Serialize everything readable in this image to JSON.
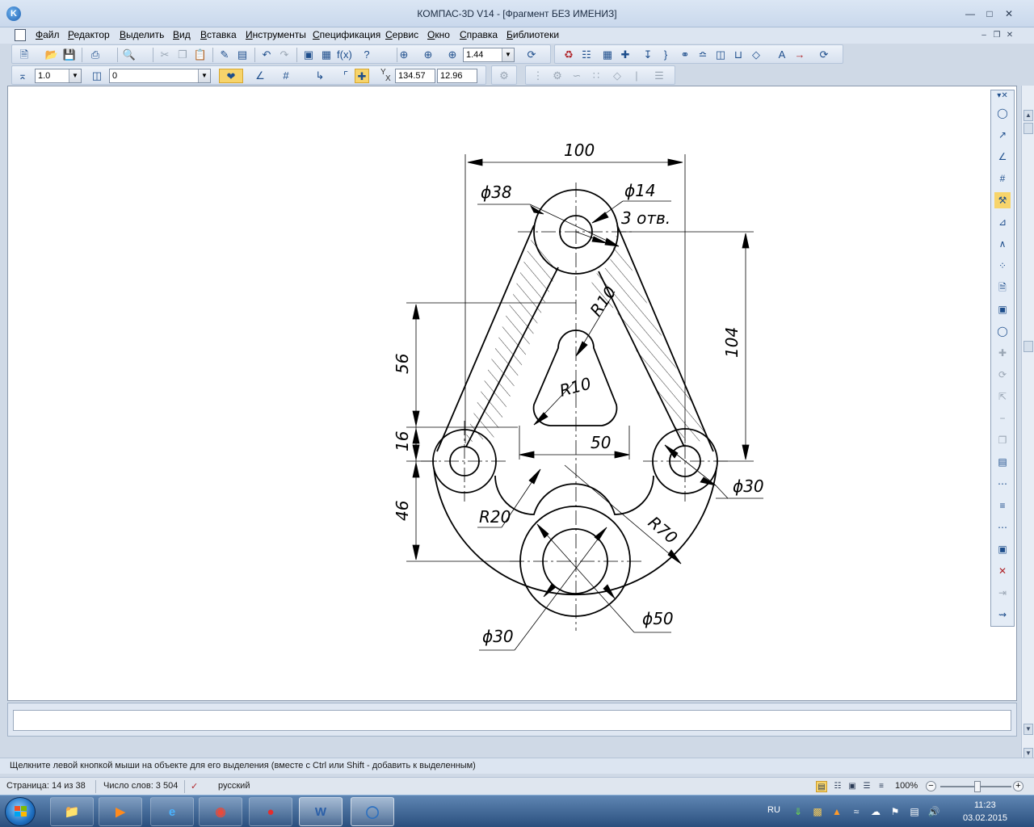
{
  "window": {
    "title": "КОМПАС-3D V14 - [Фрагмент БЕЗ ИМЕНИЗ]",
    "app_icon_letter": "K"
  },
  "menu": {
    "items": [
      "Файл",
      "Редактор",
      "Выделить",
      "Вид",
      "Вставка",
      "Инструменты",
      "Спецификация",
      "Сервис",
      "Окно",
      "Справка",
      "Библиотеки"
    ]
  },
  "toolbar": {
    "zoom_value": "1.44",
    "line_scale": "1.0",
    "layer_value": "0",
    "coord_label_y": "Y",
    "coord_label_x": "X",
    "coord_x": "134.57",
    "coord_y": "12.96"
  },
  "drawing": {
    "dim_width": "100",
    "dim_d38": "ϕ38",
    "dim_d14": "ϕ14",
    "dim_holes": "3 отв.",
    "dim_r10_top": "R10",
    "dim_r10_inner": "R10",
    "dim_56": "56",
    "dim_16": "16",
    "dim_46": "46",
    "dim_104": "104",
    "dim_50": "50",
    "dim_d30_right": "ϕ30",
    "dim_r20": "R20",
    "dim_r70": "R70",
    "dim_d30_bottom": "ϕ30",
    "dim_d50": "ϕ50"
  },
  "status": {
    "hint": "Щелкните левой кнопкой мыши на объекте для его выделения (вместе с Ctrl или Shift - добавить к выделенным)"
  },
  "word_status": {
    "page": "Страница: 14 из 38",
    "words": "Число слов: 3 504",
    "language": "русский",
    "zoom": "100%"
  },
  "taskbar": {
    "lang": "RU",
    "time": "11:23",
    "date": "03.02.2015",
    "word_label": "W"
  },
  "colors": {
    "accent": "#1e4e8c",
    "highlight": "#f7d46b"
  }
}
